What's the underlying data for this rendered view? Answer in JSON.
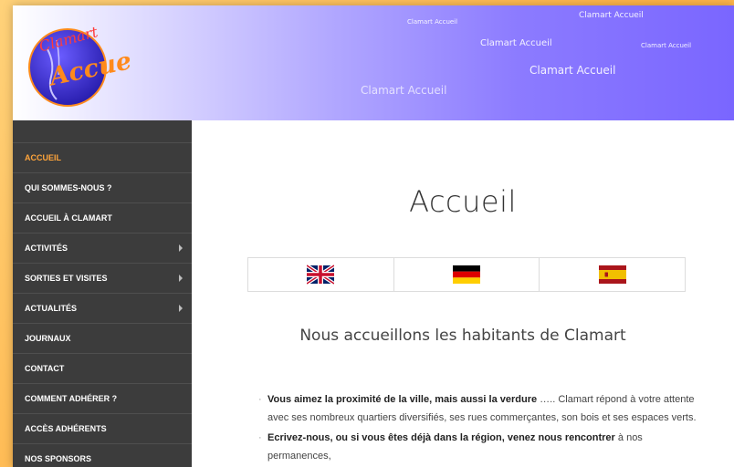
{
  "site": {
    "floating_texts": [
      "Clamart Accueil",
      "Clamart Accueil",
      "Clamart Accueil",
      "Clamart Accueil",
      "Clamart Accueil",
      "Clamart Accueil"
    ],
    "logo": {
      "text_top": "Clamart",
      "text_bottom": "Accueil"
    }
  },
  "menu": {
    "items": [
      {
        "label": "Accueil",
        "active": true,
        "submenu": false
      },
      {
        "label": "Qui sommes-nous ?",
        "active": false,
        "submenu": false
      },
      {
        "label": "Accueil à Clamart",
        "active": false,
        "submenu": false
      },
      {
        "label": "Activités",
        "active": false,
        "submenu": true
      },
      {
        "label": "Sorties et visites",
        "active": false,
        "submenu": true
      },
      {
        "label": "Actualités",
        "active": false,
        "submenu": true
      },
      {
        "label": "Journaux",
        "active": false,
        "submenu": false
      },
      {
        "label": "Contact",
        "active": false,
        "submenu": false
      },
      {
        "label": "Comment adhérer ?",
        "active": false,
        "submenu": false
      },
      {
        "label": "Accès adhérents",
        "active": false,
        "submenu": false
      },
      {
        "label": "Nos sponsors",
        "active": false,
        "submenu": false
      }
    ],
    "colors": {
      "background": "#3c3c3c",
      "active": "#ffa53b"
    }
  },
  "main": {
    "title": "Accueil",
    "flags": [
      "united-kingdom-flag",
      "germany-flag",
      "spain-flag"
    ],
    "subtitle": "Nous accueillons les habitants de Clamart",
    "paragraphs": [
      {
        "bold": "Vous aimez la proximité de la ville, mais aussi la verdure",
        "text": " ….. Clamart répond à votre attente avec ses nombreux quartiers diversifiés, ses rues commerçantes, son bois et ses espaces verts."
      },
      {
        "bold": "Ecrivez-nous, ou si vous êtes déjà dans la région, venez nous rencontrer",
        "text": " à nos permanences,"
      }
    ]
  }
}
